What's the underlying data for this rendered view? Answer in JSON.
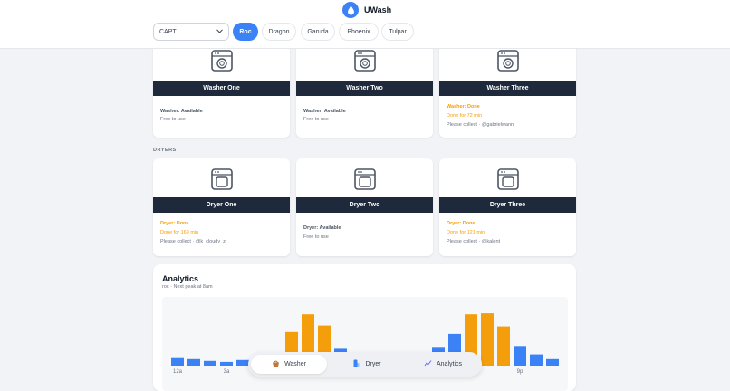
{
  "app": {
    "name": "UWash"
  },
  "filter": {
    "selected": "CAPT"
  },
  "buildings": [
    {
      "label": "Roc",
      "active": true
    },
    {
      "label": "Dragon",
      "active": false
    },
    {
      "label": "Garuda",
      "active": false
    },
    {
      "label": "Phoenix",
      "active": false
    },
    {
      "label": "Tulpar",
      "active": false
    }
  ],
  "washers": [
    {
      "name": "Washer One",
      "status": "Washer: Available",
      "detail": "Free to use"
    },
    {
      "name": "Washer Two",
      "status": "Washer: Available",
      "detail": "Free to use"
    },
    {
      "name": "Washer Three",
      "status": "Washer: Done",
      "detail": "Done for 72 min",
      "collect": "Please collect · @gabrielwann"
    }
  ],
  "dryers_label": "DRYERS",
  "dryers": [
    {
      "name": "Dryer One",
      "status": "Dryer: Done",
      "detail": "Done for 169 min",
      "collect": "Please collect · @k_cloudy_z"
    },
    {
      "name": "Dryer Two",
      "status": "Dryer: Available",
      "detail": "Free to use"
    },
    {
      "name": "Dryer Three",
      "status": "Dryer: Done",
      "detail": "Done for 121 min",
      "collect": "Please collect · @kalent"
    }
  ],
  "colors": {
    "accent": "#3b82f6",
    "done": "#f59e0b",
    "dark": "#1e293b",
    "peak": "#f59e0b",
    "normal": "#3b82f6"
  },
  "analytics": {
    "title": "Analytics",
    "subtitle": "roc · Next peak at 8am"
  },
  "chart_data": {
    "type": "bar",
    "x": [
      0,
      1,
      2,
      3,
      4,
      5,
      6,
      7,
      8,
      9,
      10,
      11,
      12,
      13,
      14,
      15,
      16,
      17,
      18,
      19,
      20,
      21,
      22,
      23
    ],
    "values": [
      9,
      7,
      5,
      4,
      6,
      6,
      14,
      36,
      55,
      43,
      18,
      12,
      7,
      4,
      6,
      11,
      20,
      34,
      55,
      56,
      42,
      21,
      12,
      7
    ],
    "peak": [
      false,
      false,
      false,
      false,
      false,
      false,
      false,
      true,
      true,
      true,
      false,
      false,
      false,
      false,
      false,
      false,
      false,
      false,
      true,
      true,
      true,
      false,
      false,
      false
    ],
    "tick_labels": [
      {
        "x": 0,
        "label": "12a"
      },
      {
        "x": 3,
        "label": "3a"
      },
      {
        "x": 21,
        "label": "9p"
      }
    ],
    "ylim": [
      0,
      60
    ],
    "grid": false
  },
  "nav": [
    {
      "label": "Washer",
      "icon": "basket-icon",
      "active": true
    },
    {
      "label": "Dryer",
      "icon": "dryer-icon",
      "active": false
    },
    {
      "label": "Analytics",
      "icon": "chart-icon",
      "active": false
    }
  ]
}
